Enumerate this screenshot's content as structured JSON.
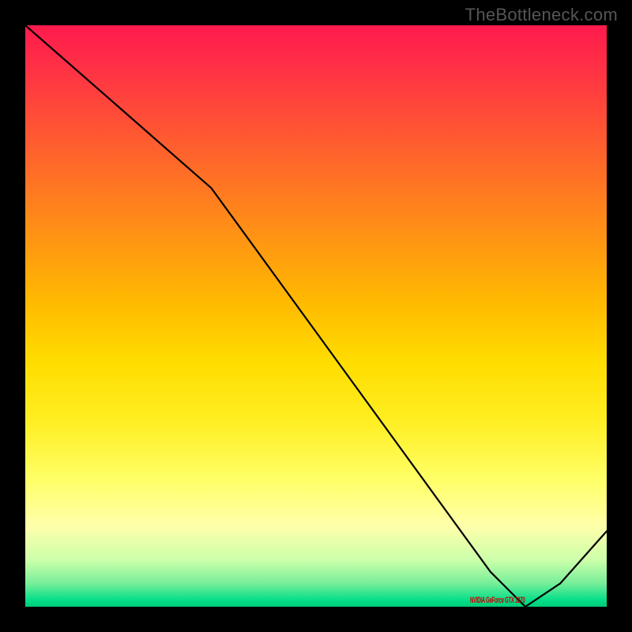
{
  "watermark": "TheBottleneck.com",
  "chart_data": {
    "type": "line",
    "title": "",
    "xlabel": "",
    "ylabel": "",
    "xlim": [
      0,
      100
    ],
    "ylim": [
      0,
      100
    ],
    "x": [
      0,
      8,
      16,
      24,
      32,
      40,
      48,
      56,
      64,
      72,
      80,
      86,
      92,
      100
    ],
    "values": [
      100,
      93,
      86,
      79,
      72,
      61,
      50,
      39,
      28,
      17,
      6,
      0,
      4,
      13
    ],
    "min_point": {
      "x": 86,
      "y": 0,
      "label": "NVIDIA GeForce GTX 1070"
    },
    "gradient_stops": [
      {
        "pos": 0,
        "color": "#ff1a4d"
      },
      {
        "pos": 50,
        "color": "#ffdd00"
      },
      {
        "pos": 88,
        "color": "#ffffaa"
      },
      {
        "pos": 100,
        "color": "#00cc77"
      }
    ]
  }
}
